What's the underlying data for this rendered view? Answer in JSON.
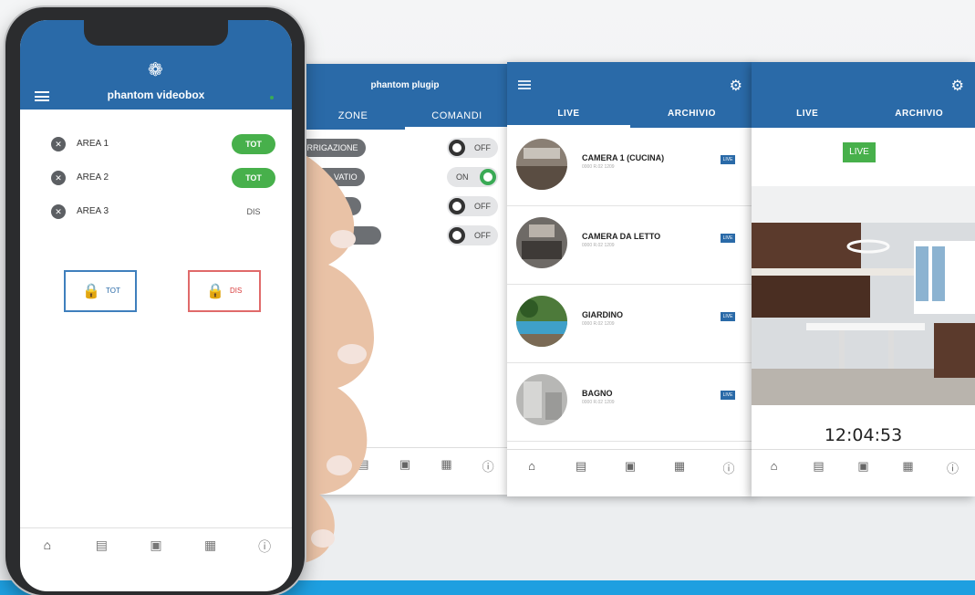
{
  "plugip": {
    "title": "phantom plugip",
    "tabs": [
      "ZONE",
      "COMANDI"
    ],
    "rows": [
      {
        "label": "IRRIGAZIONE",
        "state": "OFF"
      },
      {
        "label": "VATIO",
        "state": "ON"
      },
      {
        "label": "",
        "state": "OFF"
      },
      {
        "label": "",
        "state": "OFF"
      }
    ]
  },
  "cameras": {
    "tabs": [
      "LIVE",
      "ARCHIVIO"
    ],
    "items": [
      {
        "name": "CAMERA 1 (CUCINA)",
        "sub": "0000 R.02 1209",
        "badge": "LIVE"
      },
      {
        "name": "CAMERA DA LETTO",
        "sub": "0000 R.02 1209",
        "badge": "LIVE"
      },
      {
        "name": "GIARDINO",
        "sub": "0000 R.02 1209",
        "badge": "LIVE"
      },
      {
        "name": "BAGNO",
        "sub": "0000 R.02 1209",
        "badge": "LIVE"
      }
    ]
  },
  "live_view": {
    "tabs": [
      "LIVE",
      "ARCHIVIO"
    ],
    "badge": "LIVE",
    "time": "12:04:53"
  },
  "phone": {
    "title": "phantom videobox",
    "areas": [
      {
        "name": "AREA 1",
        "state": "TOT"
      },
      {
        "name": "AREA 2",
        "state": "TOT"
      },
      {
        "name": "AREA 3",
        "state": "DIS"
      }
    ],
    "buttons": {
      "tot": "TOT",
      "dis": "DIS"
    }
  },
  "icons": {
    "home": "home-icon",
    "lock": "lock-icon",
    "camera": "camera-icon",
    "events": "events-icon",
    "info": "info-icon",
    "settings": "gear-icon",
    "menu": "menu-icon"
  },
  "colors": {
    "brand_blue": "#2a6aa8",
    "green": "#47b04b",
    "red": "#d83c3c",
    "band": "#1e9fe0"
  }
}
